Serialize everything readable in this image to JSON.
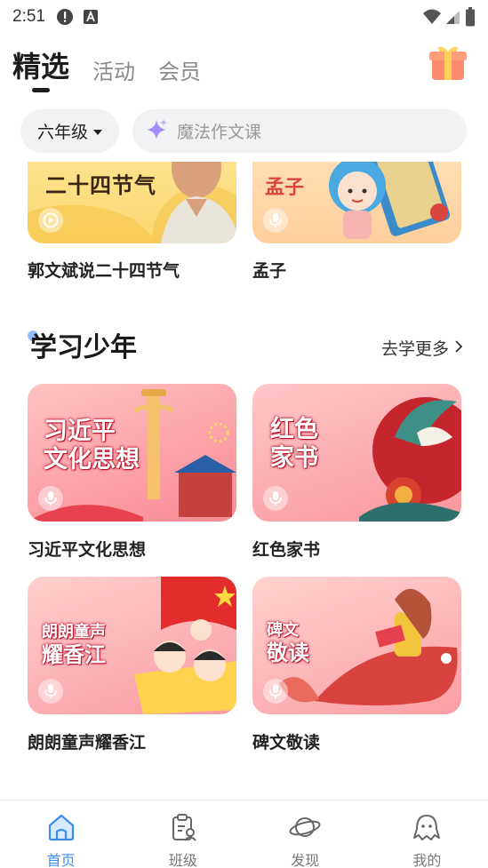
{
  "status_bar": {
    "time": "2:51"
  },
  "top_tabs": [
    {
      "label": "精选",
      "active": true
    },
    {
      "label": "活动",
      "active": false
    },
    {
      "label": "会员",
      "active": false
    }
  ],
  "filter": {
    "grade": "六年级",
    "search_placeholder": "魔法作文课"
  },
  "top_cards": [
    {
      "title": "郭文斌说二十四节气",
      "thumb_text": "二十四节气",
      "badge_icon": "play-icon"
    },
    {
      "title": "孟子",
      "thumb_text": "孟子",
      "badge_icon": "mic-icon"
    }
  ],
  "section": {
    "title": "学习少年",
    "more_label": "去学更多"
  },
  "section_cards": [
    {
      "title": "习近平文化思想",
      "thumb_text": [
        "习近平",
        "文化思想"
      ],
      "badge_icon": "mic-icon"
    },
    {
      "title": "红色家书",
      "thumb_text": [
        "红色",
        "家书"
      ],
      "badge_icon": "mic-icon"
    },
    {
      "title": "朗朗童声耀香江",
      "thumb_text": [
        "朗朗童声",
        "耀香江"
      ],
      "badge_icon": "mic-icon"
    },
    {
      "title": "碑文敬读",
      "thumb_text": [
        "碑文",
        "敬读"
      ],
      "badge_icon": "mic-icon"
    }
  ],
  "bottom_nav": [
    {
      "label": "首页",
      "icon": "home-icon",
      "active": true
    },
    {
      "label": "班级",
      "icon": "class-icon",
      "active": false
    },
    {
      "label": "发现",
      "icon": "planet-icon",
      "active": false
    },
    {
      "label": "我的",
      "icon": "profile-icon",
      "active": false
    }
  ],
  "colors": {
    "accent": "#3c8cf5",
    "card_pink": "#f9a3ab",
    "card_yellow": "#fbd66b"
  }
}
